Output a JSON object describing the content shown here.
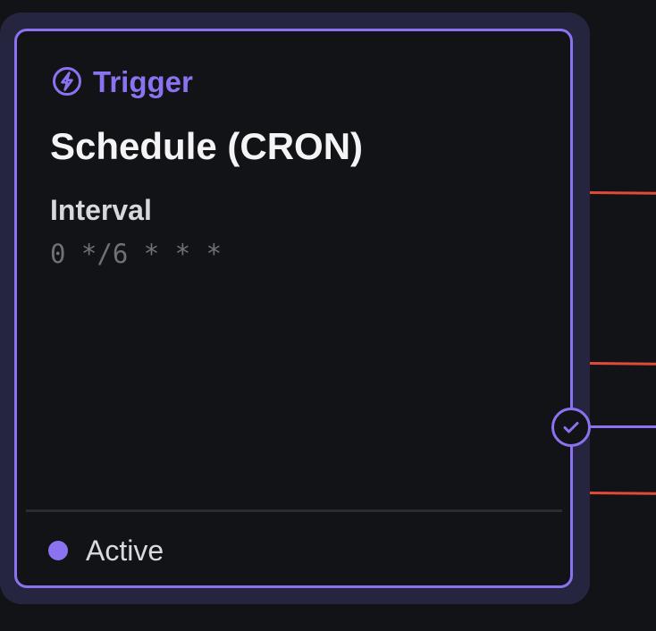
{
  "node": {
    "category": "Trigger",
    "title": "Schedule (CRON)",
    "field": {
      "label": "Interval",
      "value": "0 */6 * * *"
    },
    "status": {
      "label": "Active",
      "color": "#8b72f0"
    }
  },
  "icons": {
    "category": "bolt-icon",
    "output": "check-icon"
  },
  "colors": {
    "accent": "#8b72f0",
    "background": "#121316",
    "shell": "#26253f",
    "edge": "#df4b37",
    "text_primary": "#f4f4f7",
    "text_secondary": "#707079"
  }
}
